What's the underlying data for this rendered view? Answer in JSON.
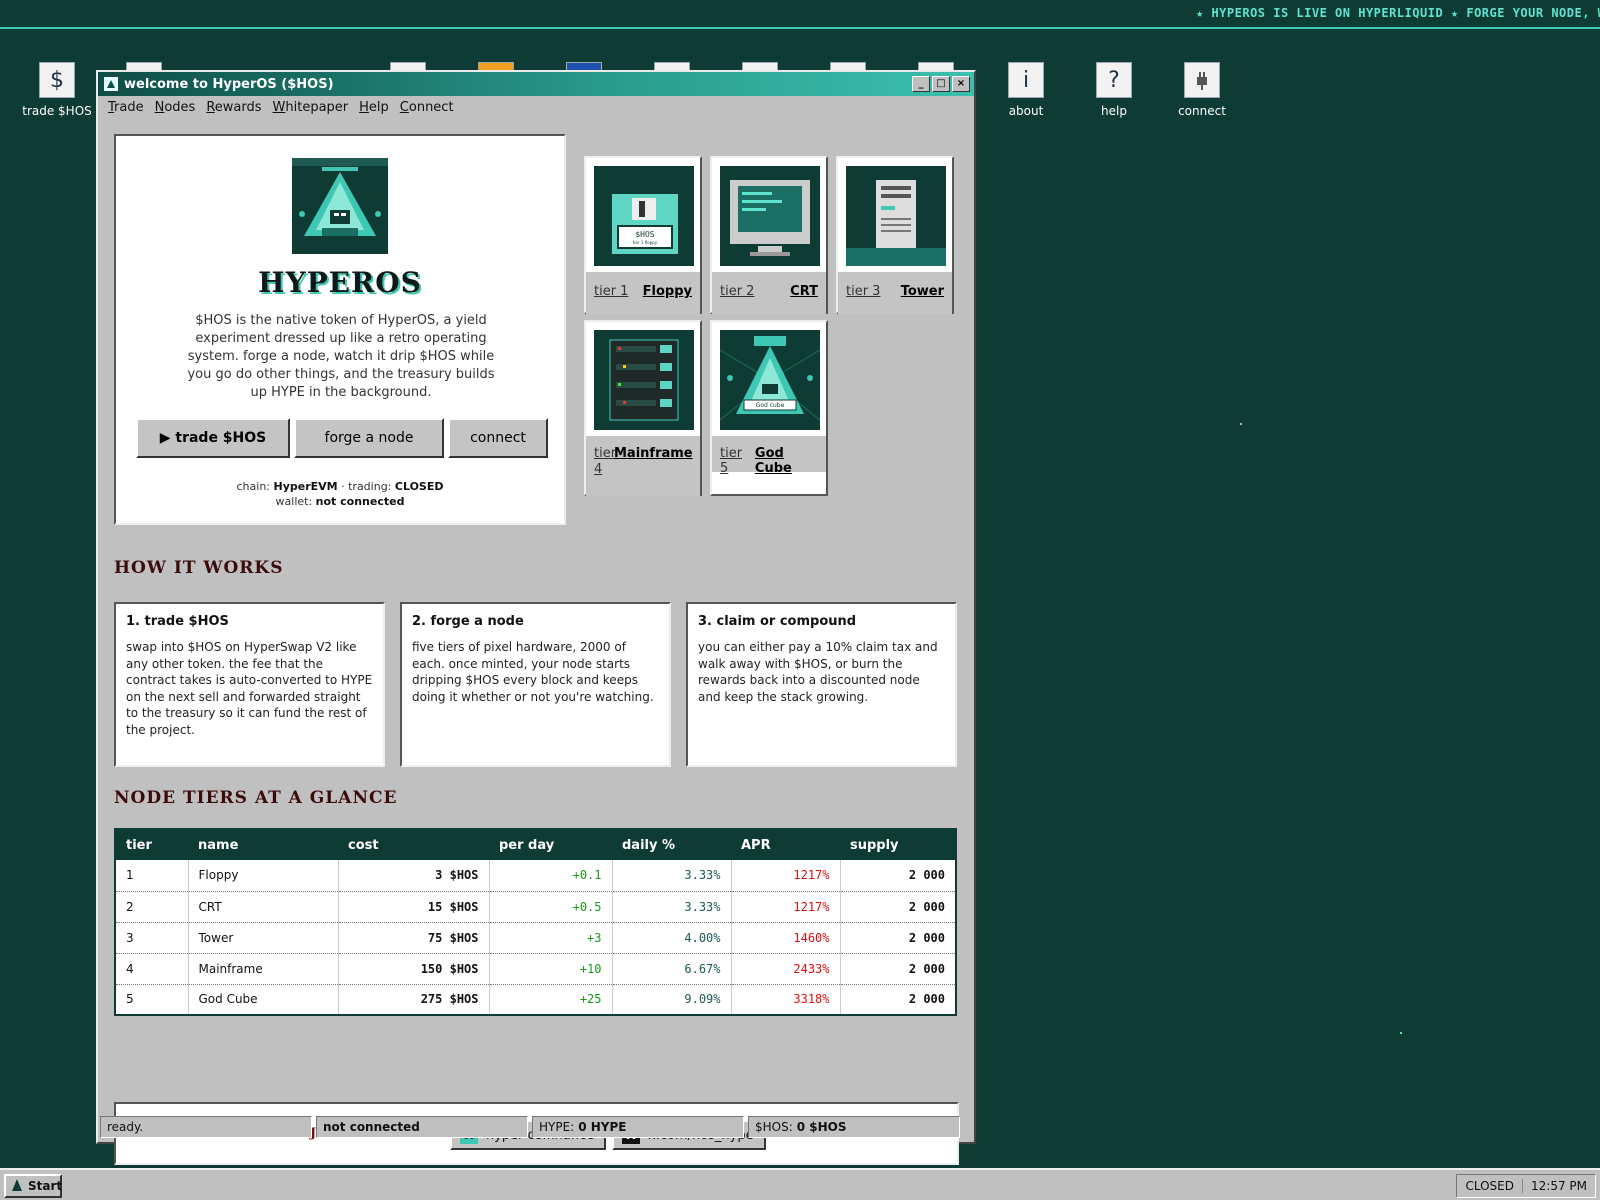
{
  "marquee": {
    "text": "★ HYPEROS IS LIVE ON HYPERLIQUID ★ FORGE YOUR NODE, WATCH IT DRI"
  },
  "desktop": {
    "left_icons": [
      {
        "glyph": "$",
        "label": "trade $HOS",
        "icon": "dollar-icon"
      }
    ],
    "right_icons": [
      {
        "glyph": "i",
        "label": "about",
        "icon": "info-icon"
      },
      {
        "glyph": "?",
        "label": "help",
        "icon": "question-icon"
      },
      {
        "glyph": "🔌",
        "label": "connect",
        "icon": "plug-icon"
      }
    ]
  },
  "window": {
    "title": "welcome to HyperOS ($HOS)",
    "controls": {
      "minimize": "_",
      "maximize": "□",
      "close": "×"
    },
    "menu": [
      "Trade",
      "Nodes",
      "Rewards",
      "Whitepaper",
      "Help",
      "Connect"
    ]
  },
  "hero": {
    "logo_caption": "HyperOS",
    "brand": "HYPEROS",
    "description": "$HOS is the native token of HyperOS, a yield experiment dressed up like a retro operating system. forge a node, watch it drip $HOS while you go do other things, and the treasury builds up HYPE in the background.",
    "buttons": {
      "trade": "▶ trade $HOS",
      "forge": "forge a node",
      "connect": "connect"
    },
    "chain_label": "chain:",
    "chain": "HyperEVM",
    "trading_label": "· trading:",
    "trading": "CLOSED",
    "wallet_label": "wallet:",
    "wallet": "not connected"
  },
  "tier_cards": [
    {
      "tier": "tier 1",
      "name": "Floppy",
      "image_text": "$HOS",
      "image_sub": "tier 1 floppy"
    },
    {
      "tier": "tier 2",
      "name": "CRT"
    },
    {
      "tier": "tier 3",
      "name": "Tower"
    },
    {
      "tier": "tier 4",
      "name": "Mainframe"
    },
    {
      "tier": "tier 5",
      "name": "God Cube",
      "image_text": "God cube"
    }
  ],
  "how_it_works": {
    "heading": "HOW IT WORKS",
    "steps": [
      {
        "title": "1. trade $HOS",
        "body": "swap into $HOS on HyperSwap V2 like any other token. the fee that the contract takes is auto-converted to HYPE on the next sell and forwarded straight to the treasury so it can fund the rest of the project."
      },
      {
        "title": "2. forge a node",
        "body": "five tiers of pixel hardware, 2000 of each. once minted, your node starts dripping $HOS every block and keeps doing it whether or not you're watching."
      },
      {
        "title": "3. claim or compound",
        "body": "you can either pay a 10% claim tax and walk away with $HOS, or burn the rewards back into a discounted node and keep the stack growing."
      }
    ]
  },
  "node_tiers": {
    "heading": "NODE TIERS AT A GLANCE",
    "columns": [
      "tier",
      "name",
      "cost",
      "per day",
      "daily %",
      "APR",
      "supply"
    ],
    "rows": [
      {
        "tier": "1",
        "name": "Floppy",
        "cost": "3 $HOS",
        "per_day": "+0.1",
        "daily": "3.33%",
        "apr": "1217%",
        "supply": "2 000"
      },
      {
        "tier": "2",
        "name": "CRT",
        "cost": "15 $HOS",
        "per_day": "+0.5",
        "daily": "3.33%",
        "apr": "1217%",
        "supply": "2 000"
      },
      {
        "tier": "3",
        "name": "Tower",
        "cost": "75 $HOS",
        "per_day": "+3",
        "daily": "4.00%",
        "apr": "1460%",
        "supply": "2 000"
      },
      {
        "tier": "4",
        "name": "Mainframe",
        "cost": "150 $HOS",
        "per_day": "+10",
        "daily": "6.67%",
        "apr": "2433%",
        "supply": "2 000"
      },
      {
        "tier": "5",
        "name": "God Cube",
        "cost": "275 $HOS",
        "per_day": "+25",
        "daily": "9.09%",
        "apr": "3318%",
        "supply": "2 000"
      }
    ]
  },
  "join": {
    "label": "JOIN THE CULT →",
    "site": {
      "icon_glyph": "W",
      "text": "hyper-os.finance"
    },
    "x": {
      "icon_glyph": "X",
      "text": "x.com/hos_hype"
    }
  },
  "statusbar": {
    "ready": "ready.",
    "wallet": "not connected",
    "hype_label": "HYPE:",
    "hype_value": "0 HYPE",
    "hos_label": "$HOS:",
    "hos_value": "0 $HOS"
  },
  "taskbar": {
    "start": "Start",
    "trading": "CLOSED",
    "clock": "12:57 PM"
  },
  "colors": {
    "desktop": "#0f3b35",
    "accent": "#3ec8b4",
    "apr": "#e01010",
    "per_day": "#1a9a1a"
  }
}
